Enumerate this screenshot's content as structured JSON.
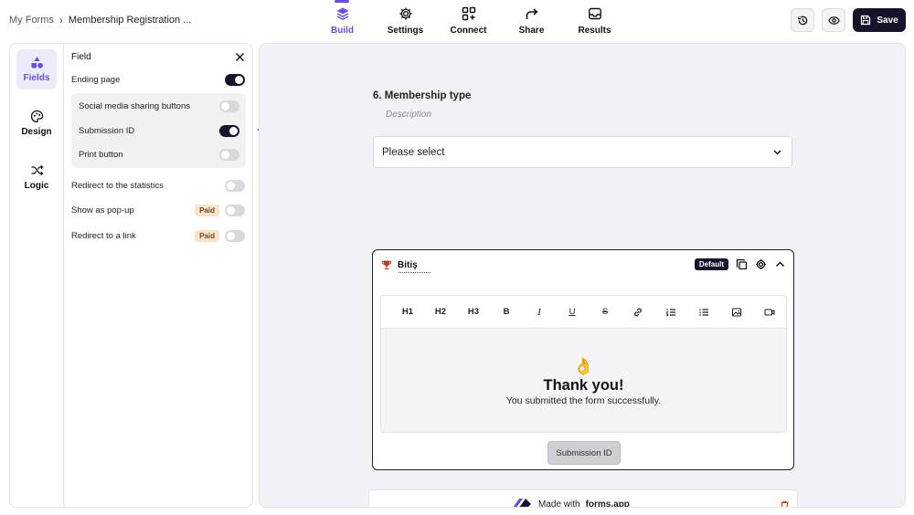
{
  "breadcrumb": {
    "parent": "My Forms",
    "separator": "›",
    "current": "Membership Registration ..."
  },
  "nav": {
    "tabs": [
      {
        "label": "Build",
        "icon": "layers-icon",
        "active": true
      },
      {
        "label": "Settings",
        "icon": "gear-icon",
        "active": false
      },
      {
        "label": "Connect",
        "icon": "connect-icon",
        "active": false
      },
      {
        "label": "Share",
        "icon": "share-icon",
        "active": false
      },
      {
        "label": "Results",
        "icon": "inbox-icon",
        "active": false
      }
    ]
  },
  "actions": {
    "save_label": "Save"
  },
  "rail": {
    "items": [
      {
        "label": "Fields",
        "icon": "shapes-icon",
        "active": true
      },
      {
        "label": "Design",
        "icon": "palette-icon",
        "active": false
      },
      {
        "label": "Logic",
        "icon": "shuffle-icon",
        "active": false
      }
    ]
  },
  "field_settings": {
    "header": "Field",
    "ending_page": {
      "label": "Ending page",
      "on": true
    },
    "sub_options": [
      {
        "label": "Social media sharing buttons",
        "on": false
      },
      {
        "label": "Submission ID",
        "on": true
      },
      {
        "label": "Print button",
        "on": false
      }
    ],
    "options": [
      {
        "label": "Redirect to the statistics",
        "on": false,
        "badge": ""
      },
      {
        "label": "Show as pop-up",
        "on": false,
        "badge": "Paid"
      },
      {
        "label": "Redirect to a link",
        "on": false,
        "badge": "Paid"
      }
    ]
  },
  "question": {
    "title": "6. Membership type",
    "description": "Description",
    "select_value": "Please select"
  },
  "ending": {
    "title": "Bitiş",
    "default_badge": "Default",
    "toolbar": [
      "H1",
      "H2",
      "H3",
      "B",
      "I",
      "U",
      "S"
    ],
    "emoji": "👌",
    "heading": "Thank you!",
    "message": "You submitted the form successfully.",
    "submission_button": "Submission ID"
  },
  "footer": {
    "made_with": "Made with",
    "brand": "forms.app"
  },
  "colors": {
    "accent": "#6b4fd8",
    "dark": "#14142b",
    "paid_badge": "#fbe3c9",
    "canvas": "#f2f2f6"
  }
}
